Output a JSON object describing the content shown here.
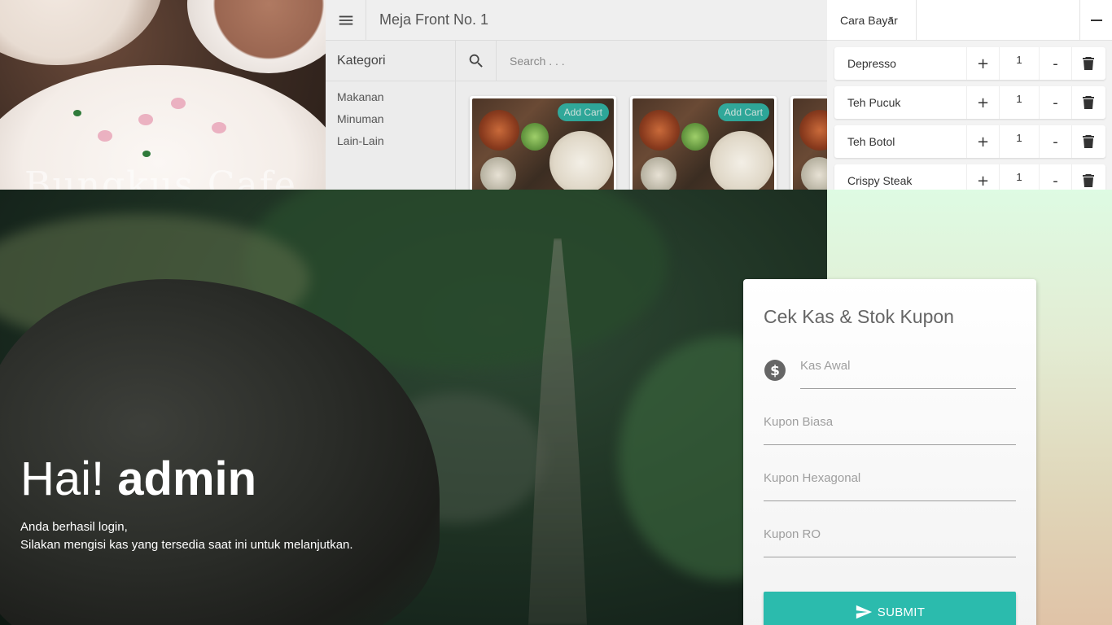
{
  "brand": {
    "ghost_text": "Bungkus Cafe"
  },
  "pos": {
    "table_title": "Meja Front No. 1",
    "kategori_label": "Kategori",
    "search": {
      "placeholder": "Search . . ."
    },
    "categories": [
      "Makanan",
      "Minuman",
      "Lain-Lain"
    ],
    "products": [
      {
        "add_label": "Add Cart"
      },
      {
        "add_label": "Add Cart"
      }
    ]
  },
  "cart": {
    "payment_label": "Cara Bayar",
    "items": [
      {
        "name": "Depresso",
        "plus": "+",
        "qty": "1",
        "minus": "-"
      },
      {
        "name": "Teh Pucuk",
        "plus": "+",
        "qty": "1",
        "minus": "-"
      },
      {
        "name": "Teh Botol",
        "plus": "+",
        "qty": "1",
        "minus": "-"
      },
      {
        "name": "Crispy Steak",
        "plus": "+",
        "qty": "1",
        "minus": "-"
      }
    ]
  },
  "login": {
    "greeting_prefix": "Hai! ",
    "username": "admin",
    "line1": "Anda berhasil login,",
    "line2": "Silakan mengisi kas yang tersedia saat ini untuk melanjutkan."
  },
  "form": {
    "title": "Cek Kas & Stok Kupon",
    "kas_awal_placeholder": "Kas Awal",
    "kupon_biasa_placeholder": "Kupon Biasa",
    "kupon_hexagonal_placeholder": "Kupon Hexagonal",
    "kupon_ro_placeholder": "Kupon RO",
    "submit_label": "SUBMIT"
  },
  "colors": {
    "accent": "#2bbbad",
    "panel": "#ececec"
  },
  "icons": {
    "menu": "hamburger-icon",
    "search": "search-icon",
    "delete": "trash-icon",
    "collapse": "minus-icon",
    "money": "dollar-circle-icon",
    "submit": "send-icon"
  }
}
